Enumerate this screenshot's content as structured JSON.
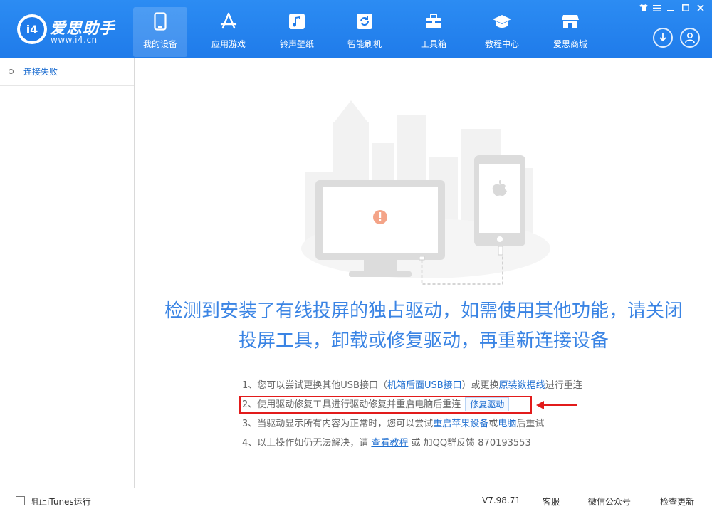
{
  "app": {
    "brand_name": "爱思助手",
    "brand_url": "www.i4.cn",
    "logo_text": "i4"
  },
  "nav": [
    {
      "label": "我的设备",
      "icon": "phone-icon",
      "active": true
    },
    {
      "label": "应用游戏",
      "icon": "app-store-icon",
      "active": false
    },
    {
      "label": "铃声壁纸",
      "icon": "music-note-icon",
      "active": false
    },
    {
      "label": "智能刷机",
      "icon": "refresh-icon",
      "active": false
    },
    {
      "label": "工具箱",
      "icon": "toolbox-icon",
      "active": false
    },
    {
      "label": "教程中心",
      "icon": "graduation-cap-icon",
      "active": false
    },
    {
      "label": "爱思商城",
      "icon": "store-icon",
      "active": false
    }
  ],
  "sidebar": {
    "items": [
      {
        "label": "连接失败"
      }
    ]
  },
  "main": {
    "headline_line1": "检测到安装了有线投屏的独占驱动，如需使用其他功能，请关闭",
    "headline_line2": "投屏工具，卸载或修复驱动，再重新连接设备",
    "tip1": {
      "prefix": "1、您可以尝试更换其他USB接口（",
      "link1": "机箱后面USB接口",
      "mid": "）或更换",
      "link2": "原装数据线",
      "suffix": "进行重连"
    },
    "tip2": {
      "text": "2、使用驱动修复工具进行驱动修复并重启电脑后重连",
      "button": "修复驱动"
    },
    "tip3": {
      "prefix": "3、当驱动显示所有内容为正常时，您可以尝试",
      "link1": "重启苹果设备",
      "mid": "或",
      "link2": "电脑",
      "suffix": "后重试"
    },
    "tip4": {
      "prefix": "4、以上操作如仍无法解决，请 ",
      "link": "查看教程",
      "suffix": " 或 加QQ群反馈 870193553"
    }
  },
  "footer": {
    "itunes_label": "阻止iTunes运行",
    "version": "V7.98.71",
    "service": "客服",
    "wechat": "微信公众号",
    "update": "检查更新"
  },
  "colors": {
    "header": "#1f7bea",
    "accent": "#3a84e4",
    "link": "#1f6fd1",
    "highlight": "#e21b1b",
    "warning": "#f4a488"
  }
}
